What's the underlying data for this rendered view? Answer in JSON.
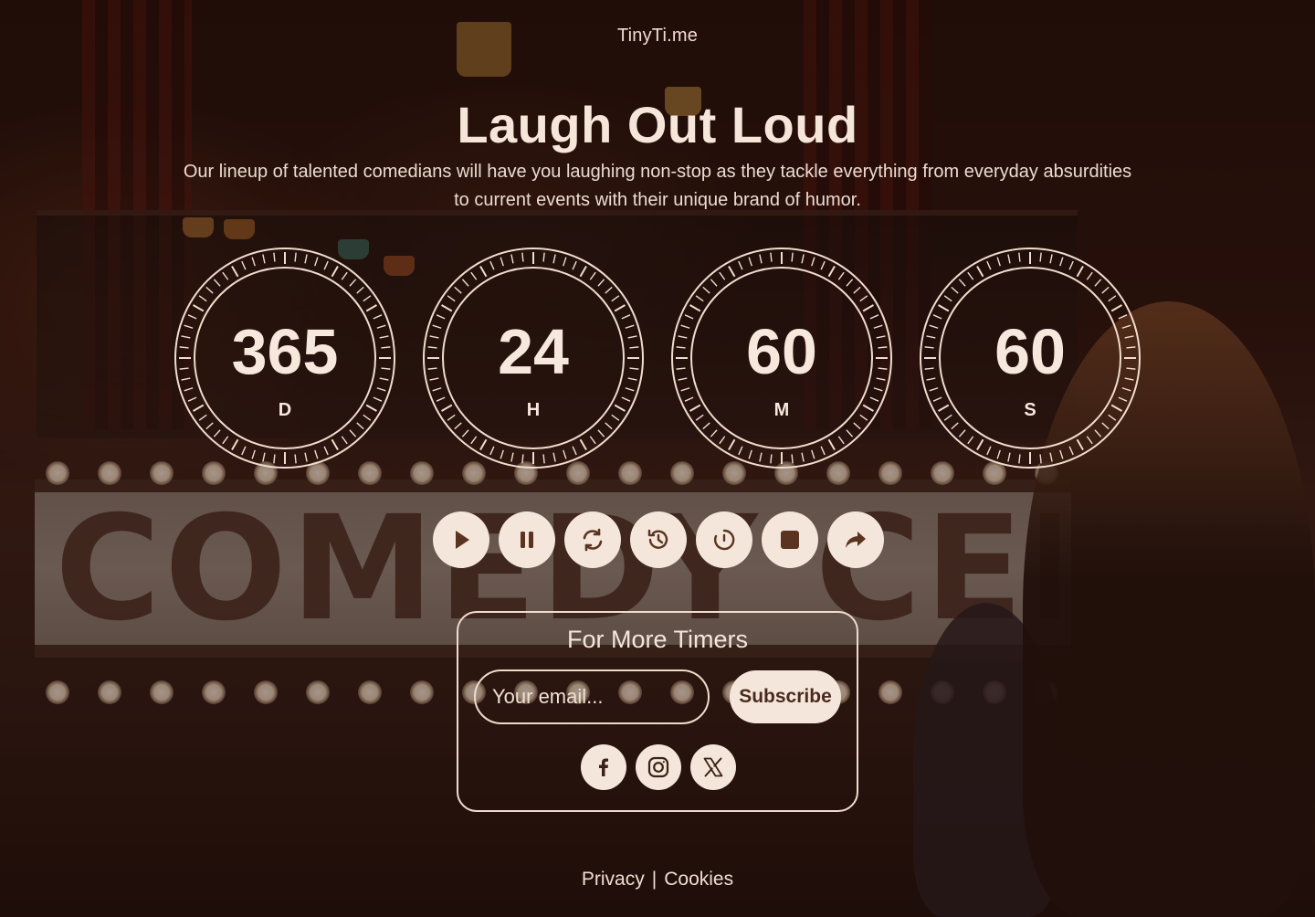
{
  "brand": "TinyTi.me",
  "hero": {
    "title": "Laugh Out Loud",
    "subtitle": "Our lineup of talented comedians will have you laughing non-stop as they tackle everything from everyday absurdities to current events with their unique brand of humor."
  },
  "timers": [
    {
      "value": "365",
      "unit": "D"
    },
    {
      "value": "24",
      "unit": "H"
    },
    {
      "value": "60",
      "unit": "M"
    },
    {
      "value": "60",
      "unit": "S"
    }
  ],
  "controls": [
    {
      "name": "play-icon"
    },
    {
      "name": "pause-icon"
    },
    {
      "name": "refresh-icon"
    },
    {
      "name": "history-icon"
    },
    {
      "name": "timer-reset-icon"
    },
    {
      "name": "stop-icon"
    },
    {
      "name": "share-icon"
    }
  ],
  "subscribe": {
    "title": "For More Timers",
    "placeholder": "Your email...",
    "button": "Subscribe"
  },
  "socials": [
    {
      "name": "facebook-icon"
    },
    {
      "name": "instagram-icon"
    },
    {
      "name": "x-twitter-icon"
    }
  ],
  "footer": {
    "privacy": "Privacy",
    "separator": "|",
    "cookies": "Cookies"
  },
  "background_text": "COMEDY CELLAR",
  "colors": {
    "accent": "#f4e6da",
    "icon_dark": "#5a3420",
    "overlay": "#230f0a"
  }
}
